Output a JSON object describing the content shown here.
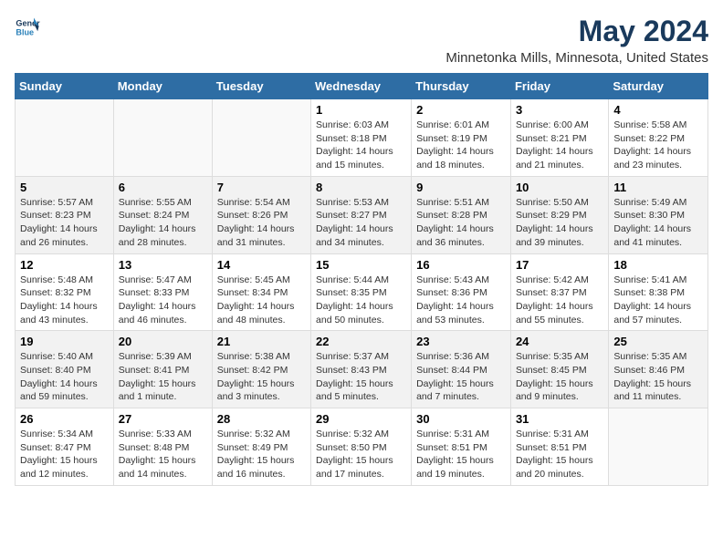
{
  "header": {
    "logo_line1": "General",
    "logo_line2": "Blue",
    "month": "May 2024",
    "location": "Minnetonka Mills, Minnesota, United States"
  },
  "weekdays": [
    "Sunday",
    "Monday",
    "Tuesday",
    "Wednesday",
    "Thursday",
    "Friday",
    "Saturday"
  ],
  "weeks": [
    [
      {
        "day": "",
        "info": ""
      },
      {
        "day": "",
        "info": ""
      },
      {
        "day": "",
        "info": ""
      },
      {
        "day": "1",
        "info": "Sunrise: 6:03 AM\nSunset: 8:18 PM\nDaylight: 14 hours\nand 15 minutes."
      },
      {
        "day": "2",
        "info": "Sunrise: 6:01 AM\nSunset: 8:19 PM\nDaylight: 14 hours\nand 18 minutes."
      },
      {
        "day": "3",
        "info": "Sunrise: 6:00 AM\nSunset: 8:21 PM\nDaylight: 14 hours\nand 21 minutes."
      },
      {
        "day": "4",
        "info": "Sunrise: 5:58 AM\nSunset: 8:22 PM\nDaylight: 14 hours\nand 23 minutes."
      }
    ],
    [
      {
        "day": "5",
        "info": "Sunrise: 5:57 AM\nSunset: 8:23 PM\nDaylight: 14 hours\nand 26 minutes."
      },
      {
        "day": "6",
        "info": "Sunrise: 5:55 AM\nSunset: 8:24 PM\nDaylight: 14 hours\nand 28 minutes."
      },
      {
        "day": "7",
        "info": "Sunrise: 5:54 AM\nSunset: 8:26 PM\nDaylight: 14 hours\nand 31 minutes."
      },
      {
        "day": "8",
        "info": "Sunrise: 5:53 AM\nSunset: 8:27 PM\nDaylight: 14 hours\nand 34 minutes."
      },
      {
        "day": "9",
        "info": "Sunrise: 5:51 AM\nSunset: 8:28 PM\nDaylight: 14 hours\nand 36 minutes."
      },
      {
        "day": "10",
        "info": "Sunrise: 5:50 AM\nSunset: 8:29 PM\nDaylight: 14 hours\nand 39 minutes."
      },
      {
        "day": "11",
        "info": "Sunrise: 5:49 AM\nSunset: 8:30 PM\nDaylight: 14 hours\nand 41 minutes."
      }
    ],
    [
      {
        "day": "12",
        "info": "Sunrise: 5:48 AM\nSunset: 8:32 PM\nDaylight: 14 hours\nand 43 minutes."
      },
      {
        "day": "13",
        "info": "Sunrise: 5:47 AM\nSunset: 8:33 PM\nDaylight: 14 hours\nand 46 minutes."
      },
      {
        "day": "14",
        "info": "Sunrise: 5:45 AM\nSunset: 8:34 PM\nDaylight: 14 hours\nand 48 minutes."
      },
      {
        "day": "15",
        "info": "Sunrise: 5:44 AM\nSunset: 8:35 PM\nDaylight: 14 hours\nand 50 minutes."
      },
      {
        "day": "16",
        "info": "Sunrise: 5:43 AM\nSunset: 8:36 PM\nDaylight: 14 hours\nand 53 minutes."
      },
      {
        "day": "17",
        "info": "Sunrise: 5:42 AM\nSunset: 8:37 PM\nDaylight: 14 hours\nand 55 minutes."
      },
      {
        "day": "18",
        "info": "Sunrise: 5:41 AM\nSunset: 8:38 PM\nDaylight: 14 hours\nand 57 minutes."
      }
    ],
    [
      {
        "day": "19",
        "info": "Sunrise: 5:40 AM\nSunset: 8:40 PM\nDaylight: 14 hours\nand 59 minutes."
      },
      {
        "day": "20",
        "info": "Sunrise: 5:39 AM\nSunset: 8:41 PM\nDaylight: 15 hours\nand 1 minute."
      },
      {
        "day": "21",
        "info": "Sunrise: 5:38 AM\nSunset: 8:42 PM\nDaylight: 15 hours\nand 3 minutes."
      },
      {
        "day": "22",
        "info": "Sunrise: 5:37 AM\nSunset: 8:43 PM\nDaylight: 15 hours\nand 5 minutes."
      },
      {
        "day": "23",
        "info": "Sunrise: 5:36 AM\nSunset: 8:44 PM\nDaylight: 15 hours\nand 7 minutes."
      },
      {
        "day": "24",
        "info": "Sunrise: 5:35 AM\nSunset: 8:45 PM\nDaylight: 15 hours\nand 9 minutes."
      },
      {
        "day": "25",
        "info": "Sunrise: 5:35 AM\nSunset: 8:46 PM\nDaylight: 15 hours\nand 11 minutes."
      }
    ],
    [
      {
        "day": "26",
        "info": "Sunrise: 5:34 AM\nSunset: 8:47 PM\nDaylight: 15 hours\nand 12 minutes."
      },
      {
        "day": "27",
        "info": "Sunrise: 5:33 AM\nSunset: 8:48 PM\nDaylight: 15 hours\nand 14 minutes."
      },
      {
        "day": "28",
        "info": "Sunrise: 5:32 AM\nSunset: 8:49 PM\nDaylight: 15 hours\nand 16 minutes."
      },
      {
        "day": "29",
        "info": "Sunrise: 5:32 AM\nSunset: 8:50 PM\nDaylight: 15 hours\nand 17 minutes."
      },
      {
        "day": "30",
        "info": "Sunrise: 5:31 AM\nSunset: 8:51 PM\nDaylight: 15 hours\nand 19 minutes."
      },
      {
        "day": "31",
        "info": "Sunrise: 5:31 AM\nSunset: 8:51 PM\nDaylight: 15 hours\nand 20 minutes."
      },
      {
        "day": "",
        "info": ""
      }
    ]
  ]
}
